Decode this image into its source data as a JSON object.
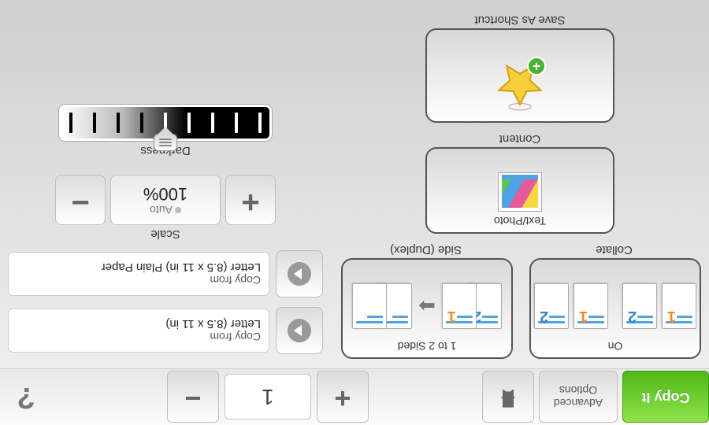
{
  "topbar": {
    "copy_label": "Copy It",
    "advanced_line1": "Advanced",
    "advanced_line2": "Options",
    "count": "1",
    "help": "?"
  },
  "collate": {
    "caption": "Collate",
    "value": "On"
  },
  "duplex": {
    "caption": "Side (Duplex)",
    "value": "1 to 2 Sided"
  },
  "content": {
    "caption": "Content",
    "value": "Text/Photo"
  },
  "shortcut": {
    "caption": "Save As Shortcut"
  },
  "copy_to": {
    "label": "Copy from",
    "value": "Letter (8.5 x 11 in)"
  },
  "copy_from": {
    "label": "Copy from",
    "value": "Letter (8.5 x 11 in) Plain Paper"
  },
  "scale": {
    "label": "Scale",
    "auto": "Auto",
    "value": "100%"
  },
  "darkness": {
    "label": "Darkness"
  }
}
